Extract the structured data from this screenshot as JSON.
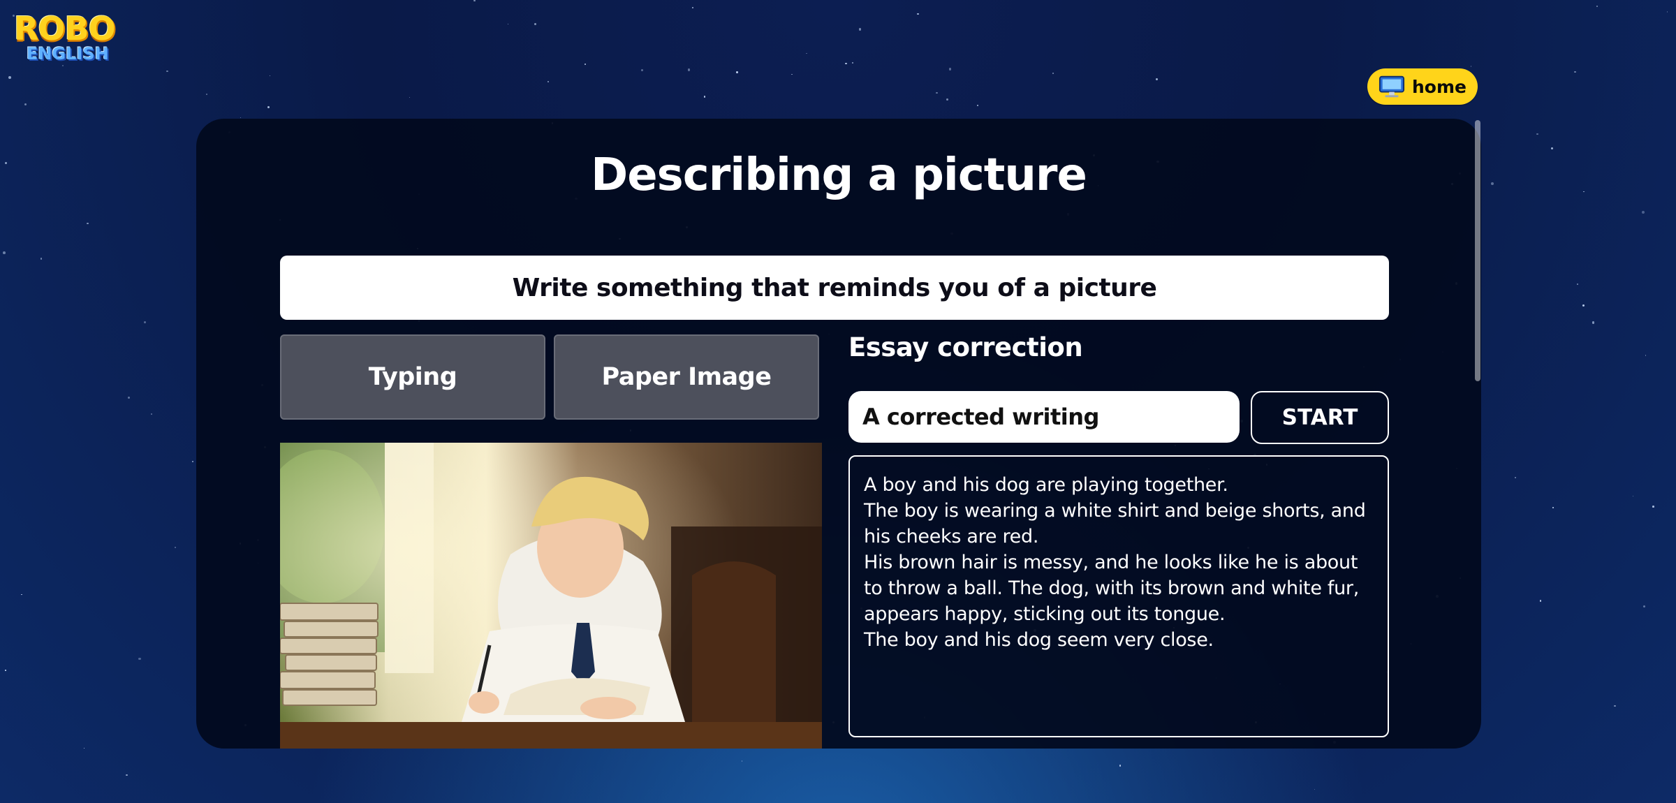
{
  "logo": {
    "line1": "ROBO",
    "line2": "ENGLISH"
  },
  "nav": {
    "home_label": "home",
    "home_icon": "computer-monitor-icon"
  },
  "page": {
    "title": "Describing a picture",
    "prompt": "Write something that reminds you of a picture"
  },
  "tabs": [
    {
      "label": "Typing"
    },
    {
      "label": "Paper Image"
    }
  ],
  "essay": {
    "heading": "Essay correction",
    "mode_value": "A corrected writing",
    "start_label": "START",
    "text": "A boy and his dog are playing together.\nThe boy is wearing a white shirt and beige shorts, and his cheeks are red.\nHis brown hair is messy, and he looks like he is about to throw a ball. The dog, with its brown and white fur, appears happy, sticking out its tongue.\nThe boy and his dog seem very close."
  },
  "colors": {
    "background": "#0b1d50",
    "panel": "#020a1e",
    "accent_yellow": "#ffd41a",
    "tab_bg": "#4d505c"
  }
}
